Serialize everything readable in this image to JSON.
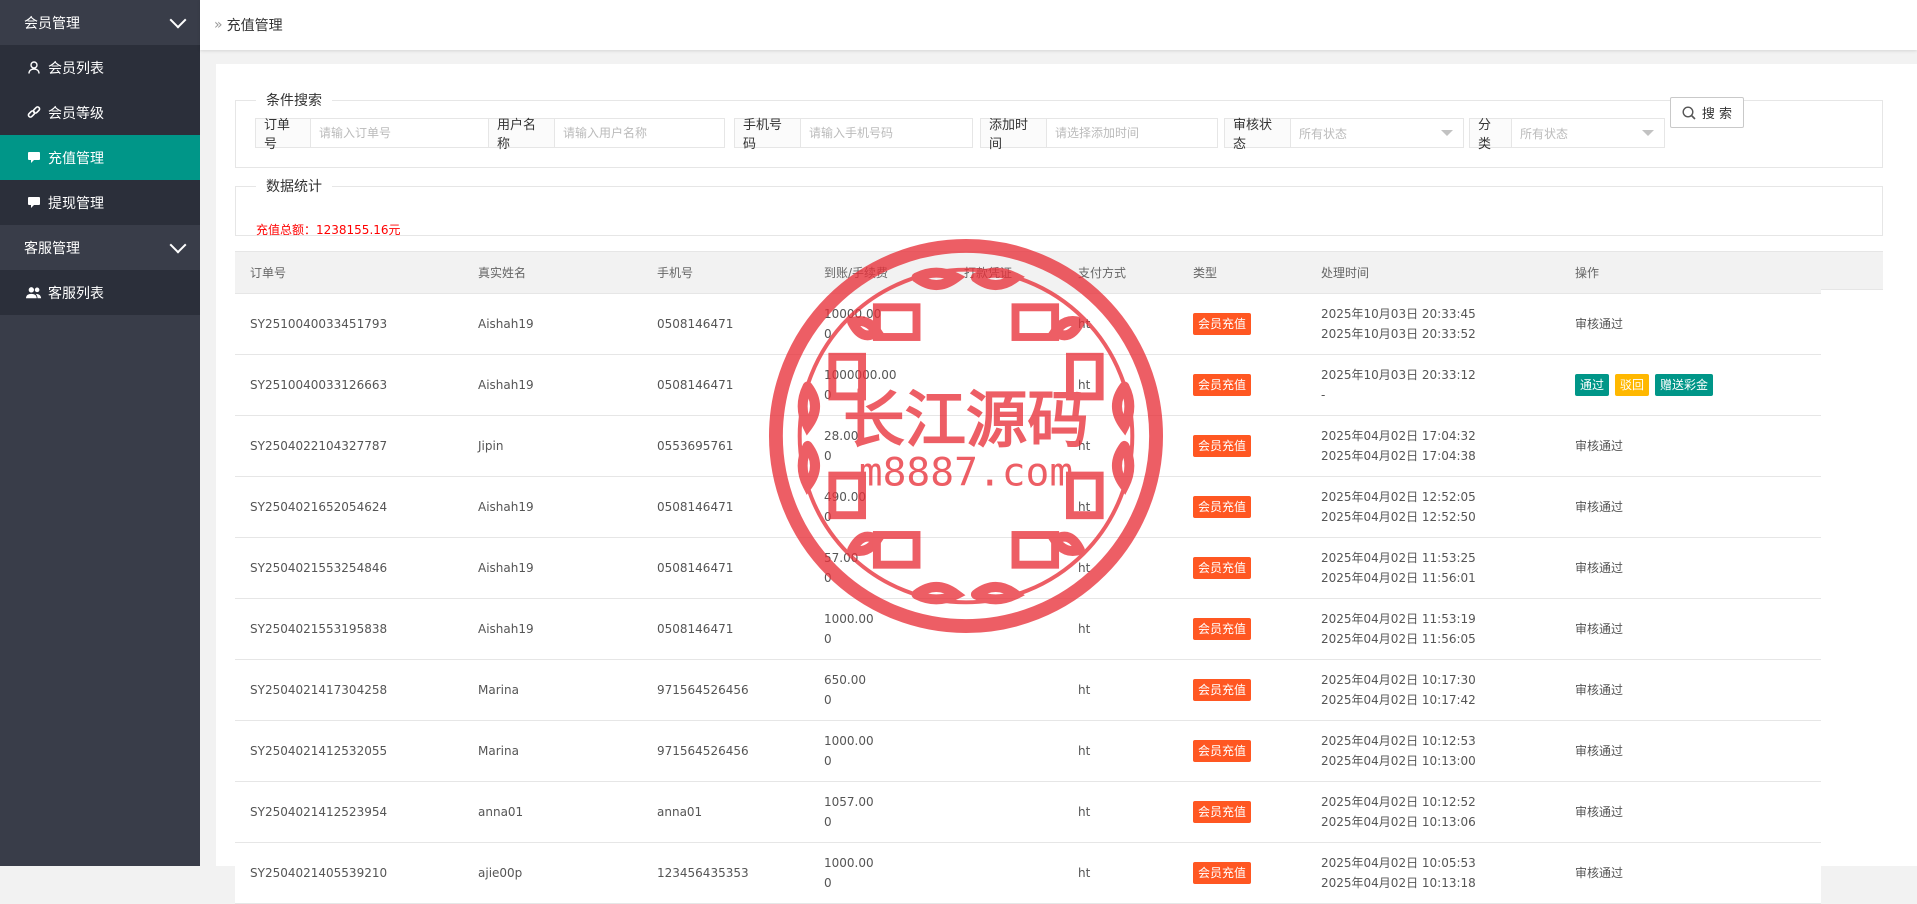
{
  "sidebar": {
    "groups": [
      {
        "label": "会员管理",
        "items": [
          {
            "label": "会员列表",
            "icon": "user-icon"
          },
          {
            "label": "会员等级",
            "icon": "link-icon"
          },
          {
            "label": "充值管理",
            "icon": "chat-icon",
            "active": true
          },
          {
            "label": "提现管理",
            "icon": "chat-icon"
          }
        ]
      },
      {
        "label": "客服管理",
        "items": [
          {
            "label": "客服列表",
            "icon": "users-icon"
          }
        ]
      }
    ]
  },
  "breadcrumb": {
    "icon": "»",
    "current": "充值管理"
  },
  "search": {
    "legend": "条件搜索",
    "fields": [
      {
        "label": "订单号",
        "placeholder": "请输入订单号"
      },
      {
        "label": "用户名称",
        "placeholder": "请输入用户名称"
      },
      {
        "label": "手机号码",
        "placeholder": "请输入手机号码"
      },
      {
        "label": "添加时间",
        "placeholder": "请选择添加时间"
      },
      {
        "label": "审核状态",
        "value": "所有状态"
      },
      {
        "label": "分类",
        "value": "所有状态"
      }
    ],
    "button": "搜 索"
  },
  "stats": {
    "legend": "数据统计",
    "total_text": "充值总额：1238155.16元"
  },
  "table": {
    "headers": [
      "订单号",
      "真实姓名",
      "手机号",
      "到账/手续费",
      "打款凭证",
      "支付方式",
      "类型",
      "处理时间",
      "操作"
    ],
    "rows": [
      {
        "order": "SY2510040033451793",
        "name": "Aishah19",
        "phone": "0508146471",
        "amount": "10000.00",
        "fee": "0",
        "pay": "ht",
        "type": "会员充值",
        "time1": "2025年10月03日 20:33:45",
        "time2": "2025年10月03日 20:33:52",
        "op": "审核通过"
      },
      {
        "order": "SY2510040033126663",
        "name": "Aishah19",
        "phone": "0508146471",
        "amount": "1000000.00",
        "fee": "0",
        "pay": "ht",
        "type": "会员充值",
        "time1": "2025年10月03日 20:33:12",
        "time2": "-",
        "op": "",
        "actions": [
          "通过",
          "驳回",
          "赠送彩金"
        ]
      },
      {
        "order": "SY2504022104327787",
        "name": "Jipin",
        "phone": "0553695761",
        "amount": "28.00",
        "fee": "0",
        "pay": "ht",
        "type": "会员充值",
        "time1": "2025年04月02日 17:04:32",
        "time2": "2025年04月02日 17:04:38",
        "op": "审核通过"
      },
      {
        "order": "SY2504021652054624",
        "name": "Aishah19",
        "phone": "0508146471",
        "amount": "490.00",
        "fee": "0",
        "pay": "ht",
        "type": "会员充值",
        "time1": "2025年04月02日 12:52:05",
        "time2": "2025年04月02日 12:52:50",
        "op": "审核通过"
      },
      {
        "order": "SY2504021553254846",
        "name": "Aishah19",
        "phone": "0508146471",
        "amount": "57.00",
        "fee": "0",
        "pay": "ht",
        "type": "会员充值",
        "time1": "2025年04月02日 11:53:25",
        "time2": "2025年04月02日 11:56:01",
        "op": "审核通过"
      },
      {
        "order": "SY2504021553195838",
        "name": "Aishah19",
        "phone": "0508146471",
        "amount": "1000.00",
        "fee": "0",
        "pay": "ht",
        "type": "会员充值",
        "time1": "2025年04月02日 11:53:19",
        "time2": "2025年04月02日 11:56:05",
        "op": "审核通过"
      },
      {
        "order": "SY2504021417304258",
        "name": "Marina",
        "phone": "971564526456",
        "amount": "650.00",
        "fee": "0",
        "pay": "ht",
        "type": "会员充值",
        "time1": "2025年04月02日 10:17:30",
        "time2": "2025年04月02日 10:17:42",
        "op": "审核通过"
      },
      {
        "order": "SY2504021412532055",
        "name": "Marina",
        "phone": "971564526456",
        "amount": "1000.00",
        "fee": "0",
        "pay": "ht",
        "type": "会员充值",
        "time1": "2025年04月02日 10:12:53",
        "time2": "2025年04月02日 10:13:00",
        "op": "审核通过"
      },
      {
        "order": "SY2504021412523954",
        "name": "anna01",
        "phone": "anna01",
        "amount": "1057.00",
        "fee": "0",
        "pay": "ht",
        "type": "会员充值",
        "time1": "2025年04月02日 10:12:52",
        "time2": "2025年04月02日 10:13:06",
        "op": "审核通过"
      },
      {
        "order": "SY2504021405539210",
        "name": "ajie00p",
        "phone": "123456435353",
        "amount": "1000.00",
        "fee": "0",
        "pay": "ht",
        "type": "会员充值",
        "time1": "2025年04月02日 10:05:53",
        "time2": "2025年04月02日 10:13:18",
        "op": "审核通过"
      }
    ]
  },
  "watermark": {
    "line1": "长江源码",
    "line2": "m8887.com"
  },
  "colors": {
    "sidebar": "#393d49",
    "active": "#009688",
    "badge": "#ff5722",
    "reject": "#ffb800",
    "stat": "#ff0000",
    "watermark": "#e8313a"
  }
}
